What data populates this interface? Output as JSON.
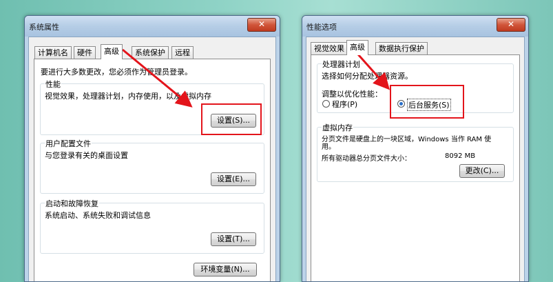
{
  "left_window": {
    "title": "系统属性",
    "close_glyph": "✕",
    "tabs": [
      "计算机名",
      "硬件",
      "高级",
      "系统保护",
      "远程"
    ],
    "admin_notice": "要进行大多数更改，您必须作为管理员登录。",
    "performance": {
      "title": "性能",
      "description": "视觉效果，处理器计划，内存使用，以及虚拟内存",
      "button": "设置(S)..."
    },
    "user_profile": {
      "title": "用户配置文件",
      "description": "与您登录有关的桌面设置",
      "button": "设置(E)..."
    },
    "startup_recovery": {
      "title": "启动和故障恢复",
      "description": "系统启动、系统失败和调试信息",
      "button": "设置(T)..."
    },
    "env_button": "环境变量(N)..."
  },
  "right_window": {
    "title": "性能选项",
    "close_glyph": "✕",
    "tabs": [
      "视觉效果",
      "高级",
      "数据执行保护"
    ],
    "processor": {
      "title": "处理器计划",
      "description": "选择如何分配处理器资源。",
      "adjust_label": "调整以优化性能：",
      "option_programs": "程序(P)",
      "option_services": "后台服务(S)",
      "selected": "后台服务(S)"
    },
    "virtual_memory": {
      "title": "虚拟内存",
      "description_line1": "分页文件是硬盘上的一块区域，Windows 当作 RAM 使",
      "description_line2": "用。",
      "total_label": "所有驱动器总分页文件大小：",
      "total_value": "8092 MB",
      "button": "更改(C)..."
    }
  },
  "colors": {
    "highlight": "#e3141b",
    "titlebar": "#b5cde6",
    "close": "#c03a20"
  }
}
